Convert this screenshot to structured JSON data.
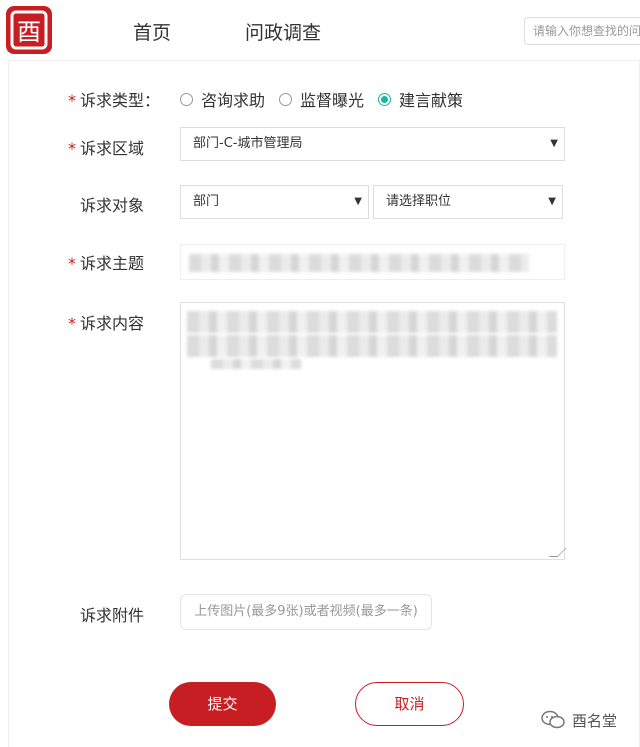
{
  "header": {
    "logo_glyph": "酉",
    "nav": [
      "首页",
      "问政调查"
    ],
    "search_placeholder": "请输入你想查找的问"
  },
  "form": {
    "type": {
      "label": "诉求类型：",
      "required": "*",
      "options": [
        "咨询求助",
        "监督曝光",
        "建言献策"
      ],
      "selected": "建言献策"
    },
    "region": {
      "label": "诉求区域",
      "required": "*",
      "value": "部门-C-城市管理局"
    },
    "target": {
      "label": "诉求对象",
      "dept_value": "部门",
      "position_value": "请选择职位"
    },
    "subject": {
      "label": "诉求主题",
      "required": "*"
    },
    "content": {
      "label": "诉求内容",
      "required": "*"
    },
    "attachment": {
      "label": "诉求附件",
      "placeholder": "上传图片(最多9张)或者视频(最多一条)"
    },
    "submit_label": "提交",
    "cancel_label": "取消"
  },
  "watermark": {
    "text": "酉名堂"
  },
  "colors": {
    "brand_red": "#c71e23",
    "radio_checked": "#19b4a6"
  }
}
